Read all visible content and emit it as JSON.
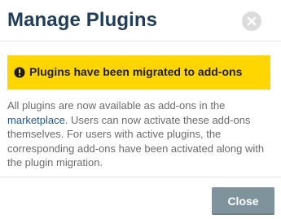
{
  "dialog": {
    "title": "Manage Plugins",
    "close_icon": "close-circle-icon",
    "alert": {
      "icon": "exclamation-circle-icon",
      "text": "Plugins have been migrated to add-ons",
      "background_color": "#ffd600"
    },
    "body": {
      "before_link": "All plugins are now available as add-ons in the ",
      "link_text": "marketplace",
      "after_link": ". Users can now activate these add-ons themselves. For users with active plugins, the corresponding add-ons have been activated along with the plugin migration."
    },
    "footer": {
      "close_button_label": "Close",
      "close_button_color": "#7f939c"
    },
    "colors": {
      "title": "#1e3d5c",
      "link": "#1e5b8f",
      "body_text": "#6b6b6b"
    }
  }
}
